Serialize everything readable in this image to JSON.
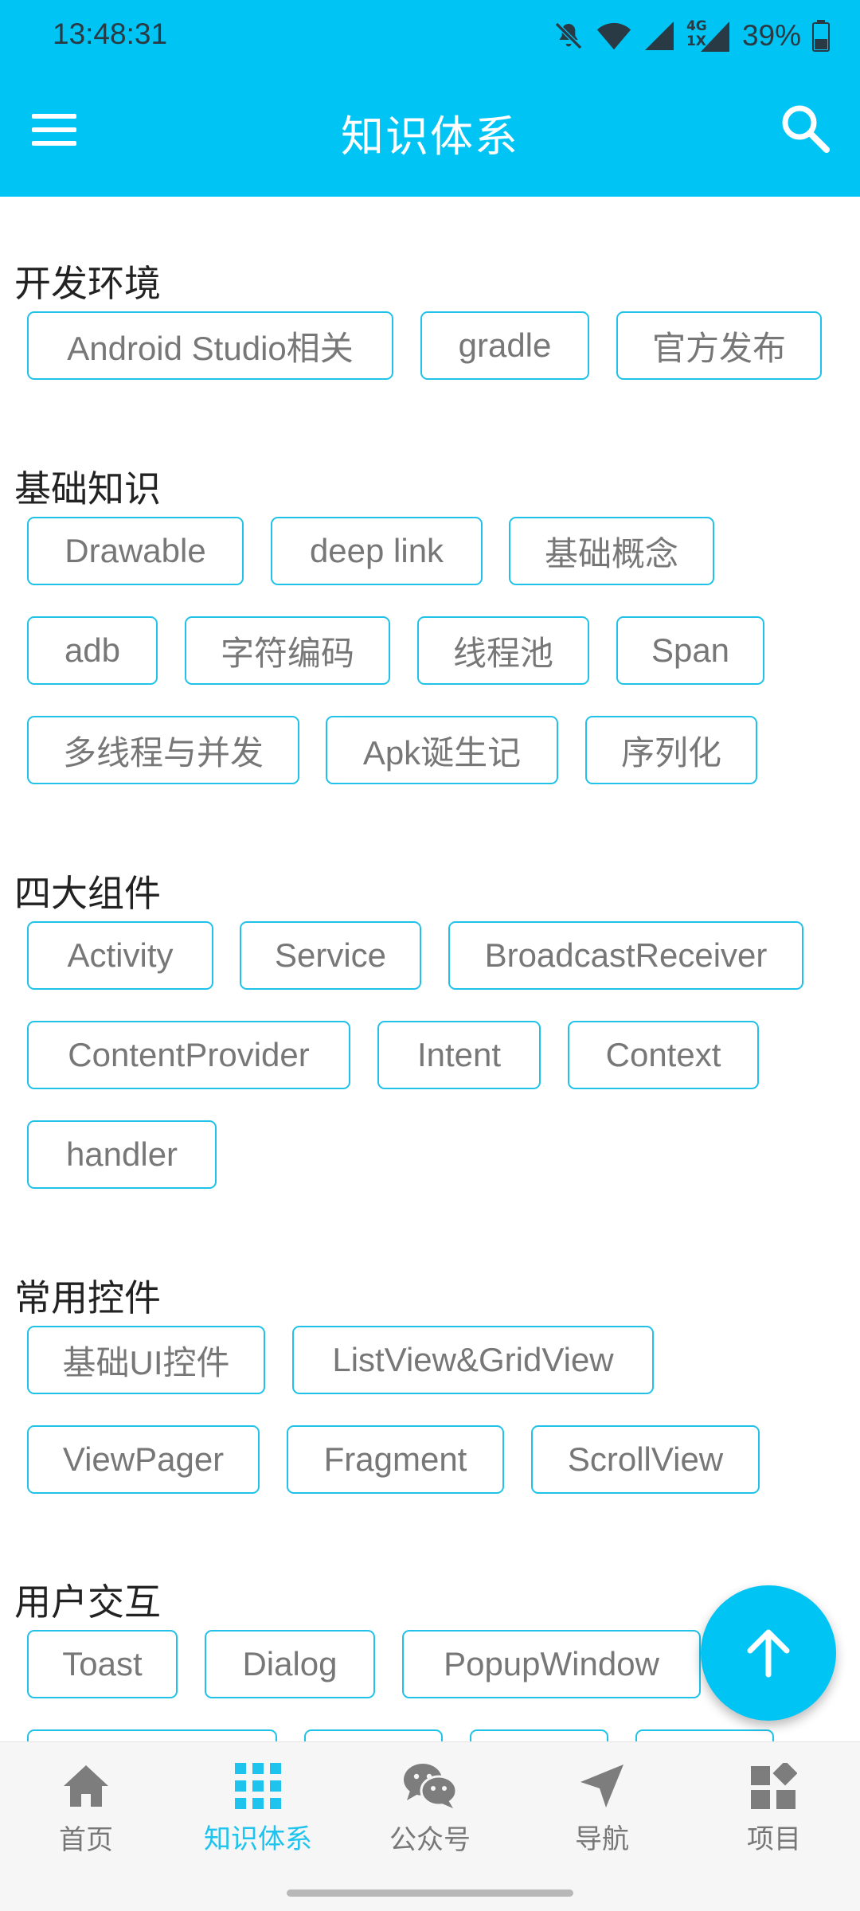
{
  "status_bar": {
    "time": "13:48:31",
    "battery_text": "39%",
    "network_type_top": "4G",
    "network_type_bottom": "1X"
  },
  "header": {
    "title": "知识体系",
    "menu_icon": "hamburger-menu-icon",
    "search_icon": "search-icon"
  },
  "sections": [
    {
      "title": "开发环境",
      "chips": [
        "Android Studio相关",
        "gradle",
        "官方发布"
      ]
    },
    {
      "title": "基础知识",
      "chips": [
        "Drawable",
        "deep link",
        "基础概念",
        "adb",
        "字符编码",
        "线程池",
        "Span",
        "多线程与并发",
        "Apk诞生记",
        "序列化"
      ]
    },
    {
      "title": "四大组件",
      "chips": [
        "Activity",
        "Service",
        "BroadcastReceiver",
        "ContentProvider",
        "Intent",
        "Context",
        "handler"
      ]
    },
    {
      "title": "常用控件",
      "chips": [
        "基础UI控件",
        "ListView&GridView",
        "ViewPager",
        "Fragment",
        "ScrollView"
      ]
    },
    {
      "title": "用户交互",
      "chips": [
        "Toast",
        "Dialog",
        "PopupWindow"
      ]
    }
  ],
  "fab": {
    "icon": "arrow-up-icon"
  },
  "bottom_nav": {
    "items": [
      {
        "label": "首页",
        "icon": "home-icon",
        "active": false
      },
      {
        "label": "知识体系",
        "icon": "grid-icon",
        "active": true
      },
      {
        "label": "公众号",
        "icon": "wechat-icon",
        "active": false
      },
      {
        "label": "导航",
        "icon": "navigation-arrow-icon",
        "active": false
      },
      {
        "label": "项目",
        "icon": "apps-icon",
        "active": false
      }
    ]
  },
  "colors": {
    "primary": "#00c4f3",
    "chip_border": "#20c2e8",
    "active_nav": "#1ec3ee"
  }
}
